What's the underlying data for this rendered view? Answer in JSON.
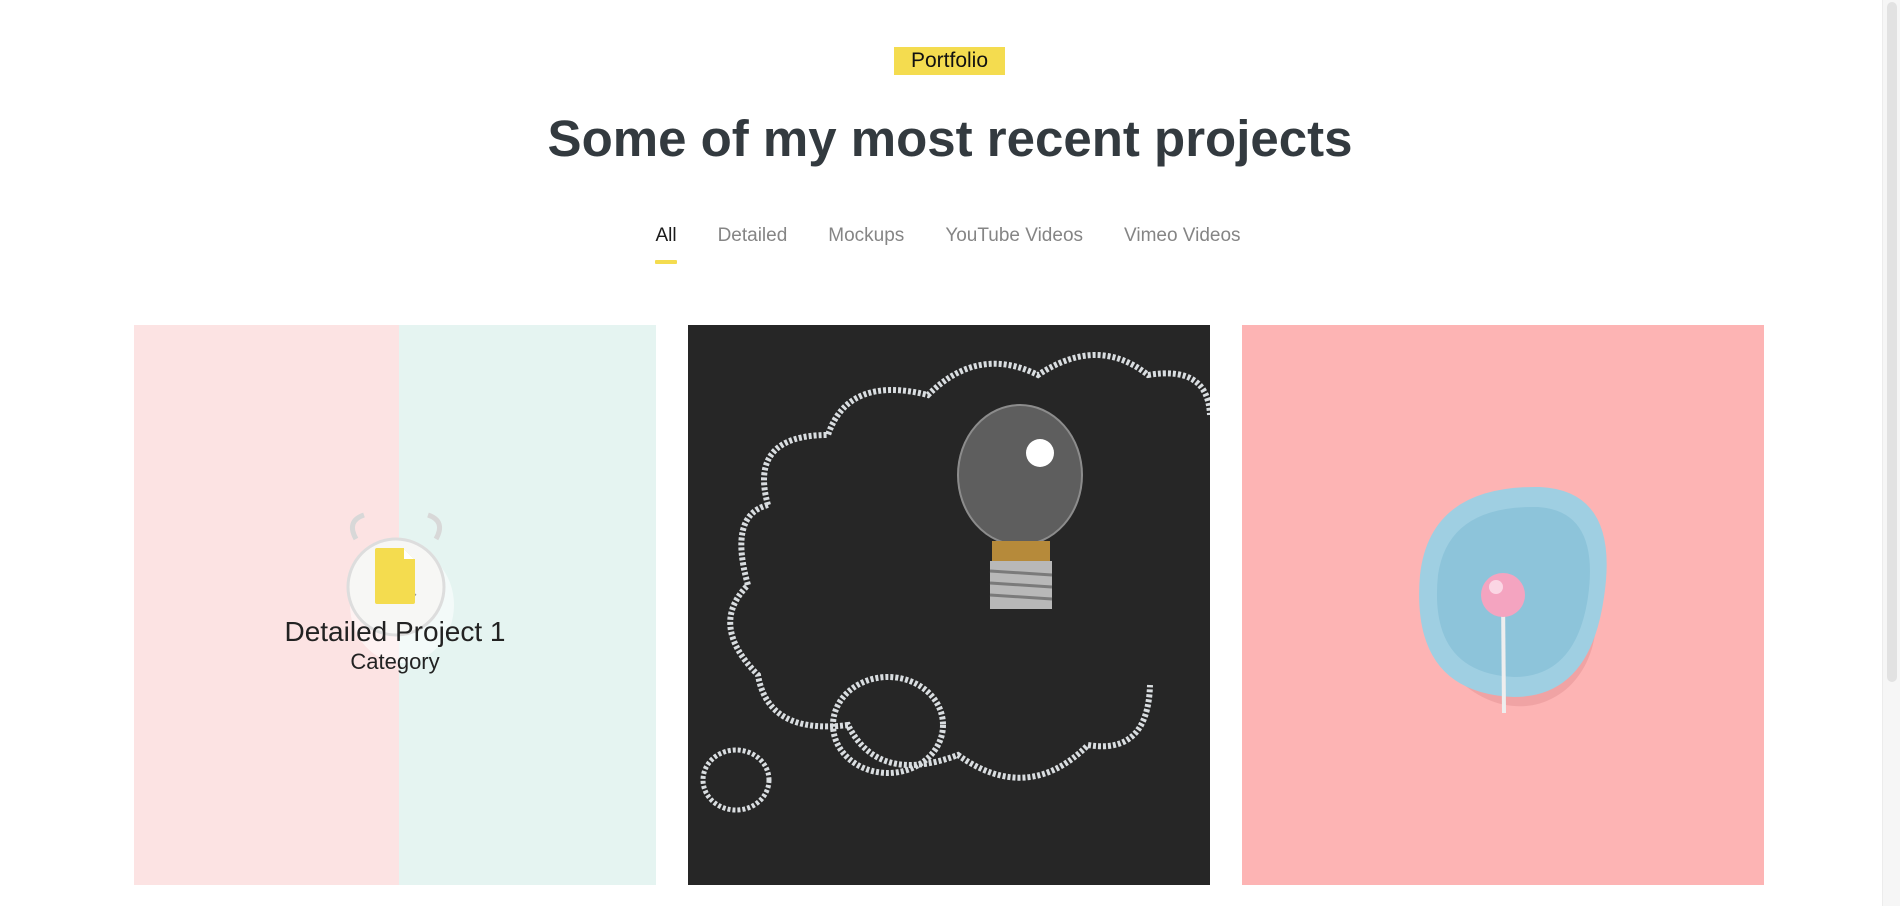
{
  "section": {
    "badge": "Portfolio",
    "title": "Some of my most recent projects"
  },
  "filters": [
    {
      "label": "All",
      "active": true
    },
    {
      "label": "Detailed",
      "active": false
    },
    {
      "label": "Mockups",
      "active": false
    },
    {
      "label": "YouTube Videos",
      "active": false
    },
    {
      "label": "Vimeo Videos",
      "active": false
    }
  ],
  "projects": [
    {
      "title": "Detailed Project 1",
      "category": "Category",
      "image": "alarm-clock-pastel-photo"
    },
    {
      "image": "lightbulb-chalkboard-photo"
    },
    {
      "image": "lollipop-plate-photo"
    }
  ],
  "colors": {
    "accent": "#f4dc4f",
    "heading": "#333a3f",
    "filter_inactive": "#858585"
  }
}
